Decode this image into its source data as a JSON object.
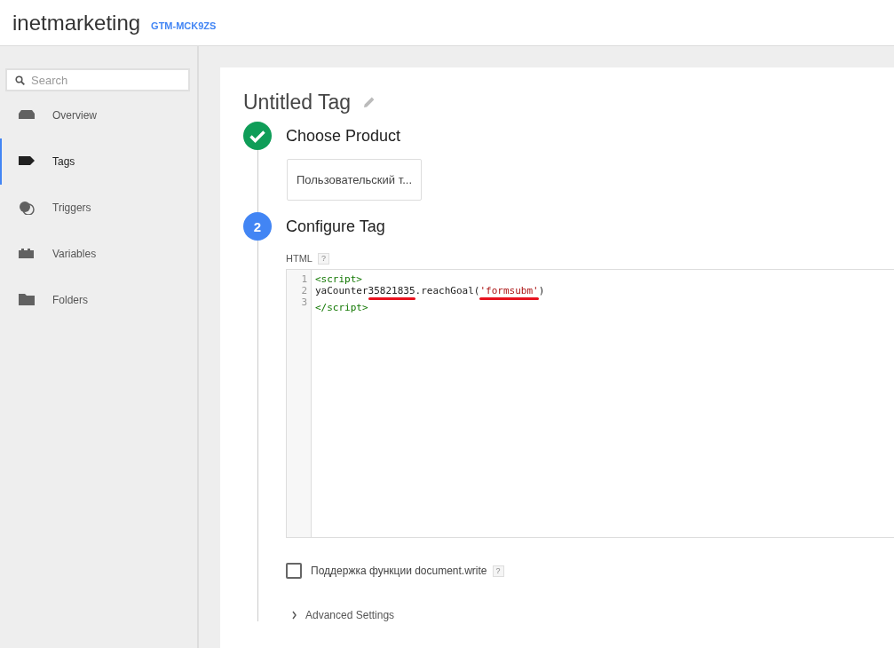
{
  "header": {
    "title": "inetmarketing",
    "container_id": "GTM-MCK9ZS"
  },
  "sidebar": {
    "search": {
      "placeholder": "Search"
    },
    "items": [
      {
        "label": "Overview",
        "kind": "overview",
        "selected": false
      },
      {
        "label": "Tags",
        "kind": "tag",
        "selected": true
      },
      {
        "label": "Triggers",
        "kind": "trigger",
        "selected": false
      },
      {
        "label": "Variables",
        "kind": "variables",
        "selected": false
      },
      {
        "label": "Folders",
        "kind": "folder",
        "selected": false
      }
    ]
  },
  "tag": {
    "title": "Untitled Tag",
    "steps": [
      {
        "kind": "done",
        "title": "Choose Product",
        "product": "Пользовательский т..."
      },
      {
        "kind": "number",
        "number": "2",
        "title": "Configure Tag",
        "field_label": "HTML",
        "help": "?",
        "code_lines": [
          {
            "number": "1",
            "tokens": [
              {
                "kind": "tag",
                "text": "<script>",
                "marked": false
              }
            ]
          },
          {
            "number": "2",
            "tokens": [
              {
                "kind": "plain",
                "text": "yaCounter",
                "marked": false
              },
              {
                "kind": "plain",
                "text": "35821835",
                "marked": true
              },
              {
                "kind": "plain",
                "text": ".reachGoal(",
                "marked": false
              },
              {
                "kind": "string",
                "text": "'formsubm'",
                "marked": true
              },
              {
                "kind": "plain",
                "text": ")",
                "marked": false
              }
            ]
          },
          {
            "number": "3",
            "tokens": [
              {
                "kind": "tag",
                "text": "</script>",
                "marked": false
              }
            ]
          }
        ],
        "checkbox": {
          "label": "Поддержка функции document.write",
          "checked": false,
          "help": "?"
        },
        "advanced": {
          "label": "Advanced Settings",
          "expanded": false
        }
      }
    ]
  }
}
